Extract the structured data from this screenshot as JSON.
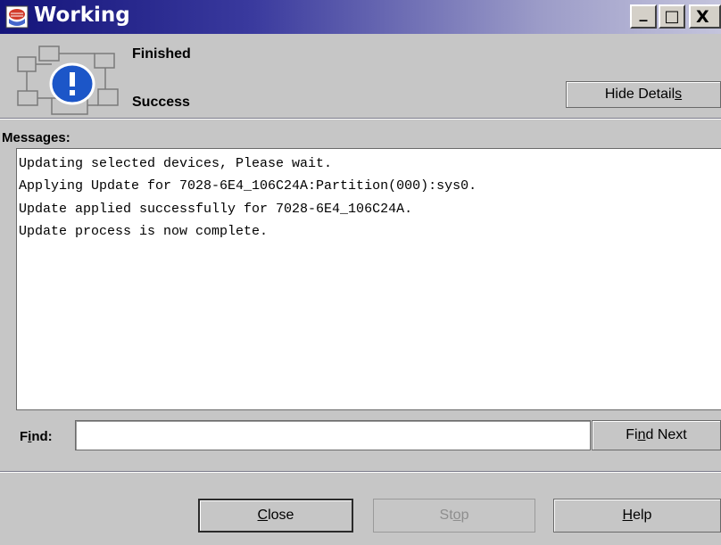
{
  "window": {
    "title": "Working",
    "controls": {
      "minimize": "_",
      "maximize": "□",
      "close": "X"
    }
  },
  "header": {
    "status_title": "Finished",
    "status_subtitle": "Success",
    "hide_details": {
      "pre": "Hide Detail",
      "mnemonic": "s",
      "post": ""
    }
  },
  "messages": {
    "label": "Messages:",
    "lines": [
      "Updating selected devices, Please wait.",
      "Applying Update for 7028-6E4_106C24A:Partition(000):sys0.",
      "Update applied successfully for 7028-6E4_106C24A.",
      "Update process is now complete."
    ]
  },
  "find": {
    "label_pre": "F",
    "label_mnemonic": "i",
    "label_post": "nd:",
    "value": "",
    "find_next": {
      "pre": "Fi",
      "mnemonic": "n",
      "post": "d Next"
    }
  },
  "buttons": {
    "close": {
      "pre": "",
      "mnemonic": "C",
      "post": "lose"
    },
    "stop": {
      "pre": "St",
      "mnemonic": "o",
      "post": "p"
    },
    "help": {
      "pre": "",
      "mnemonic": "H",
      "post": "elp"
    }
  },
  "icons": {
    "app": "app-logo-icon",
    "status": "info-network-icon"
  },
  "colors": {
    "titlebar_start": "#14147a",
    "titlebar_end": "#c4c4dc",
    "dialog_bg": "#c6c6c6",
    "info_blue": "#1c56c8"
  }
}
